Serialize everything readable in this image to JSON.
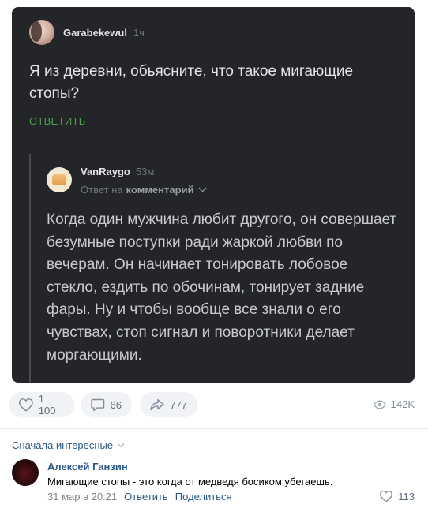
{
  "post": {
    "question_author": "Garabekewul",
    "question_time": "1ч",
    "question_text": "Я из деревни, обьясните, что такое мигающие стопы?",
    "reply_button_label": "ОТВЕТИТЬ",
    "answer_author": "VanRaygo",
    "answer_time": "53м",
    "answer_reply_prefix": "Ответ на",
    "answer_reply_target": "комментарий",
    "answer_text": "Когда один мужчина любит другого, он совершает безумные поступки ради жаркой любви по вечерам. Он начинает тонировать лобовое стекло, ездить по обочинам, тонирует задние фары. Ну и чтобы вообще все знали о его чувствах, стоп сигнал и поворотники делает моргающими."
  },
  "actions": {
    "likes": "1 100",
    "comments": "66",
    "shares": "777",
    "views": "142K"
  },
  "comments": {
    "sort_label": "Сначала интересные",
    "items": [
      {
        "author": "Алексей Ганзин",
        "text": "Мигающие стопы - это когда от медведя босиком убегаешь.",
        "date": "31 мар в 20:21",
        "reply_label": "Ответить",
        "share_label": "Поделиться",
        "likes": "113"
      }
    ]
  },
  "colors": {
    "card_background": "#242528",
    "link": "#2a5885",
    "reply_green": "#4f9b4f"
  },
  "icons": [
    "heart-icon",
    "comment-icon",
    "share-icon",
    "eye-icon",
    "chevron-down-icon"
  ]
}
